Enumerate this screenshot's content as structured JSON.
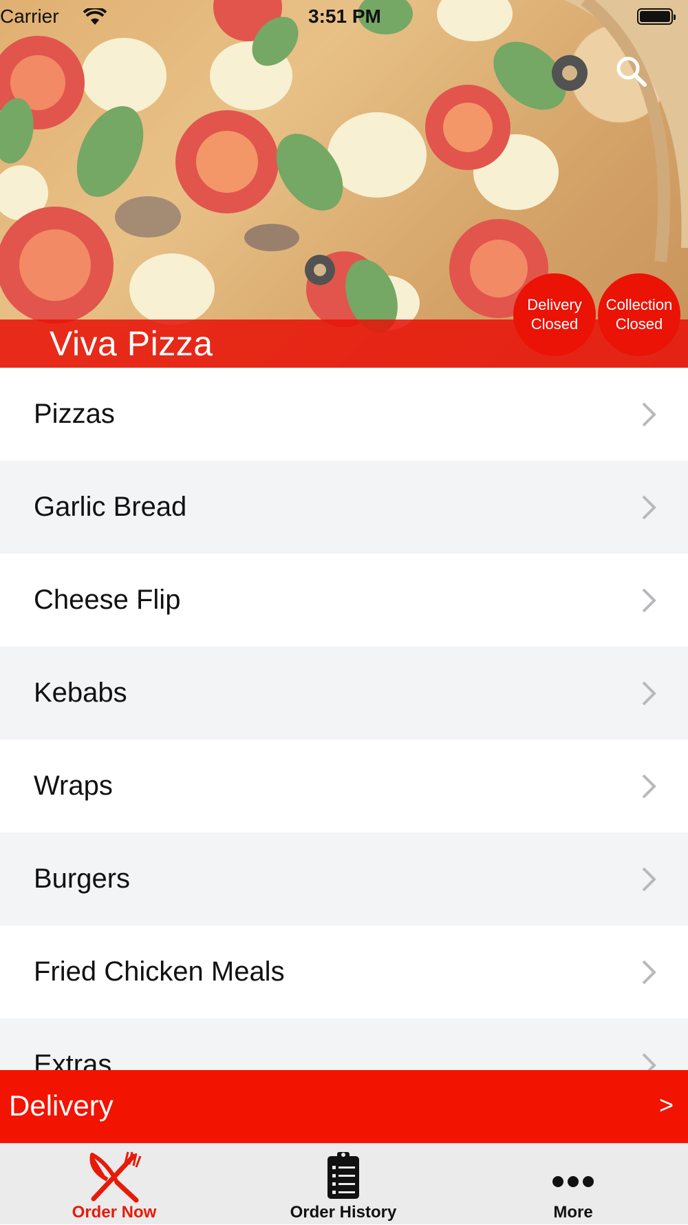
{
  "status_bar": {
    "carrier": "Carrier",
    "time": "3:51 PM"
  },
  "header": {
    "restaurant_name": "Viva Pizza",
    "delivery_status": {
      "line1": "Delivery",
      "line2": "Closed"
    },
    "collection_status": {
      "line1": "Collection",
      "line2": "Closed"
    },
    "search_icon": "search-icon",
    "accent_color": "#ea1306"
  },
  "menu": {
    "items": [
      {
        "label": "Pizzas"
      },
      {
        "label": "Garlic Bread"
      },
      {
        "label": "Cheese Flip"
      },
      {
        "label": "Kebabs"
      },
      {
        "label": "Wraps"
      },
      {
        "label": "Burgers"
      },
      {
        "label": "Fried Chicken Meals"
      },
      {
        "label": "Extras"
      }
    ]
  },
  "delivery_bar": {
    "label": "Delivery",
    "arrow": ">"
  },
  "tab_bar": {
    "tabs": [
      {
        "label": "Order Now",
        "icon": "fork-knife-icon",
        "active": true
      },
      {
        "label": "Order History",
        "icon": "clipboard-icon",
        "active": false
      },
      {
        "label": "More",
        "icon": "more-dots-icon",
        "active": false
      }
    ],
    "active_color": "#e81a08"
  }
}
